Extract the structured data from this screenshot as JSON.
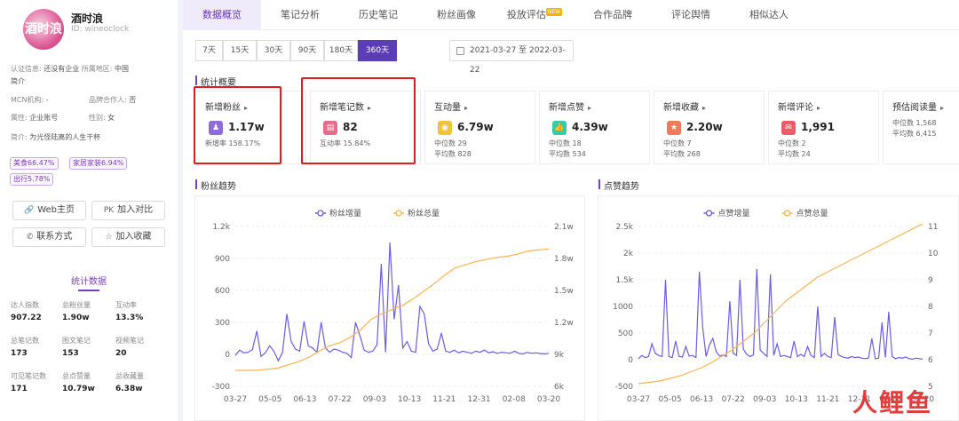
{
  "account": {
    "name": "酒时浪",
    "id": "ID: wineoclock",
    "avatar_text": "酒时浪"
  },
  "info": [
    {
      "k": "认证信息: ",
      "v": "还没有企业",
      "k2": " 所属地区: ",
      "v2": "中国"
    },
    {
      "k": "",
      "v": "简介"
    },
    {
      "k": "MCN机构: ",
      "v": "-",
      "k2": "品牌合作人: ",
      "v2": "否"
    },
    {
      "k": "属性: ",
      "v": "企业账号",
      "k2": "性别: ",
      "v2": "女"
    },
    {
      "k": "简介: ",
      "v": "为光怪陆离的人生干杯"
    }
  ],
  "tags": [
    "美食66.47%",
    "家居家装6.94%",
    "出行5.78%"
  ],
  "buttons": {
    "web": "Web主页",
    "pk": "加入对比",
    "contact": "联系方式",
    "fav": "加入收藏",
    "web_icon": "🔗",
    "pk_icon": "PK",
    "contact_icon": "✆",
    "fav_icon": "☆"
  },
  "stats": {
    "title": "统计数据",
    "items": [
      {
        "k": "达人指数",
        "v": "907.22"
      },
      {
        "k": "总粉丝量",
        "v": "1.90w"
      },
      {
        "k": "互动率",
        "v": "13.3%"
      },
      {
        "k": "总笔记数",
        "v": "173"
      },
      {
        "k": "图文笔记",
        "v": "153"
      },
      {
        "k": "视频笔记",
        "v": "20"
      },
      {
        "k": "可见笔记数",
        "v": "171"
      },
      {
        "k": "总点赞量",
        "v": "10.79w"
      },
      {
        "k": "总收藏量",
        "v": "6.38w"
      }
    ]
  },
  "tabs": [
    "数据概览",
    "笔记分析",
    "历史笔记",
    "粉丝画像",
    "投放评估",
    "合作品牌",
    "评论舆情",
    "相似达人"
  ],
  "tab_new": "NEW",
  "periods": [
    "7天",
    "15天",
    "30天",
    "90天",
    "180天",
    "360天"
  ],
  "date_range": "2021-03-27  至  2022-03-22",
  "overview_title": "统计概要",
  "cards": [
    {
      "title": "新增粉丝",
      "value": "1.17w",
      "sub": [
        "新增率 158.17%"
      ],
      "color": "#8e6cd8"
    },
    {
      "title": "新增笔记数",
      "value": "82",
      "sub": [
        "互动率 15.84%"
      ],
      "color": "#e96a8a"
    },
    {
      "title": "互动量",
      "value": "6.79w",
      "sub": [
        "中位数 29",
        "平均数 828"
      ],
      "color": "#f2c33a"
    },
    {
      "title": "新增点赞",
      "value": "4.39w",
      "sub": [
        "中位数 18",
        "平均数 534"
      ],
      "color": "#3cc9a8"
    },
    {
      "title": "新增收藏",
      "value": "2.20w",
      "sub": [
        "中位数 7",
        "平均数 268"
      ],
      "color": "#f07a5a"
    },
    {
      "title": "新增评论",
      "value": "1,991",
      "sub": [
        "中位数 2",
        "平均数 24"
      ],
      "color": "#ee5a6a"
    },
    {
      "title": "预估阅读量",
      "value": "",
      "sub": [
        "中位数 1,568",
        "平均数 6,415"
      ],
      "color": "#999"
    }
  ],
  "chart_data": [
    {
      "type": "line",
      "title": "粉丝趋势",
      "categories": [
        "03-27",
        "05-05",
        "06-13",
        "07-22",
        "09-03",
        "10-13",
        "11-21",
        "12-31",
        "02-08",
        "03-20"
      ],
      "yleft_ticks": [
        "1.2k",
        "900",
        "600",
        "300",
        "0",
        "-300"
      ],
      "yright_ticks": [
        "2.1w",
        "1.8w",
        "1.5w",
        "1.2w",
        "9k",
        "6k"
      ],
      "series": [
        {
          "name": "粉丝增量",
          "axis": "left",
          "color": "#6c5ce7",
          "values": [
            -10,
            40,
            15,
            20,
            45,
            220,
            -20,
            15,
            80,
            30,
            -60,
            20,
            380,
            120,
            50,
            30,
            310,
            80,
            60,
            20,
            300,
            60,
            20,
            50,
            40,
            20,
            10,
            -30,
            300,
            180,
            40,
            20,
            30,
            90,
            850,
            20,
            1050,
            330,
            650,
            60,
            120,
            30,
            20,
            450,
            380,
            100,
            30,
            50,
            200,
            30,
            20,
            40,
            15,
            30,
            20,
            10,
            30,
            20,
            40,
            15,
            25,
            10,
            20,
            15,
            10,
            30,
            10,
            5,
            20,
            10,
            15,
            8,
            5,
            10
          ]
        },
        {
          "name": "粉丝总量",
          "axis": "right",
          "color": "#fdb44b",
          "values": [
            7500,
            7500,
            7500,
            7600,
            7700,
            8000,
            8300,
            8700,
            9300,
            9800,
            10100,
            10600,
            11300,
            12300,
            12800,
            13200,
            13600,
            14200,
            14900,
            15600,
            16400,
            17100,
            17400,
            17700,
            17900,
            18100,
            18200,
            18400,
            18700,
            18800,
            18900
          ]
        }
      ],
      "ylim_left": [
        -300,
        1200
      ],
      "ylim_right": [
        6000,
        21000
      ]
    },
    {
      "type": "line",
      "title": "点赞趋势",
      "categories": [
        "03-27",
        "05-05",
        "06-13",
        "07-22",
        "09-03",
        "10-13",
        "11-21",
        "12-31",
        "02-08",
        "03-20"
      ],
      "yleft_ticks": [
        "2.5k",
        "2k",
        "1.5k",
        "1000",
        "500",
        "0",
        "-500"
      ],
      "yright_ticks": [
        "11",
        "10",
        "9",
        "8",
        "7",
        "6",
        "5"
      ],
      "series": [
        {
          "name": "点赞增量",
          "axis": "left",
          "color": "#6c5ce7",
          "values": [
            20,
            80,
            40,
            60,
            300,
            120,
            80,
            60,
            1500,
            60,
            40,
            350,
            60,
            50,
            250,
            70,
            80,
            40,
            1650,
            600,
            60,
            280,
            400,
            150,
            70,
            90,
            60,
            1100,
            120,
            80,
            1500,
            200,
            100,
            60,
            90,
            1700,
            180,
            120,
            60,
            1600,
            80,
            300,
            60,
            80,
            60,
            40,
            350,
            60,
            100,
            60,
            250,
            80,
            40,
            1000,
            60,
            120,
            60,
            40,
            800,
            100,
            60,
            40,
            30,
            60,
            40,
            50,
            30,
            20,
            30,
            400,
            20,
            30,
            700,
            40,
            900,
            60,
            20,
            40,
            30,
            50,
            20,
            10,
            30,
            20,
            10
          ]
        },
        {
          "name": "点赞总量",
          "axis": "right",
          "color": "#fdb44b",
          "values": [
            5.1,
            5.15,
            5.2,
            5.3,
            5.4,
            5.55,
            5.7,
            5.9,
            6.15,
            6.4,
            6.7,
            7.0,
            7.4,
            7.8,
            8.2,
            8.5,
            8.8,
            9.1,
            9.3,
            9.5,
            9.7,
            9.9,
            10.1,
            10.3,
            10.5,
            10.7,
            10.9,
            11.1
          ]
        }
      ],
      "ylim_left": [
        -500,
        2500
      ],
      "ylim_right": [
        5,
        11
      ]
    }
  ],
  "watermark": "人鲤鱼"
}
